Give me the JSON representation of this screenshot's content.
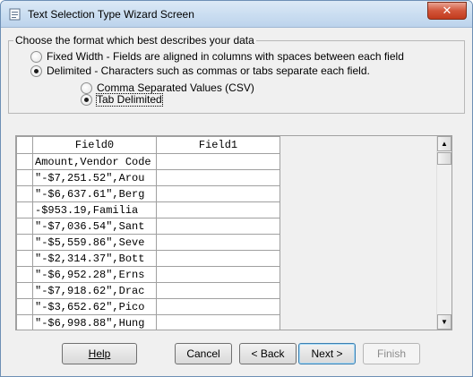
{
  "window": {
    "title": "Text Selection Type Wizard Screen",
    "close_glyph": "✕"
  },
  "format_group": {
    "legend": "Choose the format which best describes your data",
    "options": [
      {
        "label": "Fixed Width - Fields are aligned in columns with spaces between each field",
        "checked": false
      },
      {
        "label": "Delimited - Characters such as commas or tabs separate each field.",
        "checked": true
      }
    ],
    "delimiter_options": [
      {
        "label": "Comma Separated Values (CSV)",
        "checked": false
      },
      {
        "label": "Tab Delimited",
        "checked": true
      }
    ]
  },
  "grid": {
    "columns": [
      "Field0",
      "Field1"
    ],
    "rows": [
      [
        "Amount,Vendor Code",
        ""
      ],
      [
        "\"-$7,251.52\",Arou",
        ""
      ],
      [
        "\"-$6,637.61\",Berg",
        ""
      ],
      [
        "-$953.19,Familia",
        ""
      ],
      [
        "\"-$7,036.54\",Sant",
        ""
      ],
      [
        "\"-$5,559.86\",Seve",
        ""
      ],
      [
        "\"-$2,314.37\",Bott",
        ""
      ],
      [
        "\"-$6,952.28\",Erns",
        ""
      ],
      [
        "\"-$7,918.62\",Drac",
        ""
      ],
      [
        "\"-$3,652.62\",Pico",
        ""
      ],
      [
        "\"-$6,998.88\",Hung",
        ""
      ]
    ],
    "scroll_up_glyph": "▲",
    "scroll_down_glyph": "▼"
  },
  "buttons": {
    "help": "Help",
    "cancel": "Cancel",
    "back": "< Back",
    "next": "Next >",
    "finish": "Finish"
  },
  "colors": {
    "titlebar": "#c8dcf0",
    "close_button": "#c23a1d",
    "default_button_border": "#3c7fb1"
  }
}
